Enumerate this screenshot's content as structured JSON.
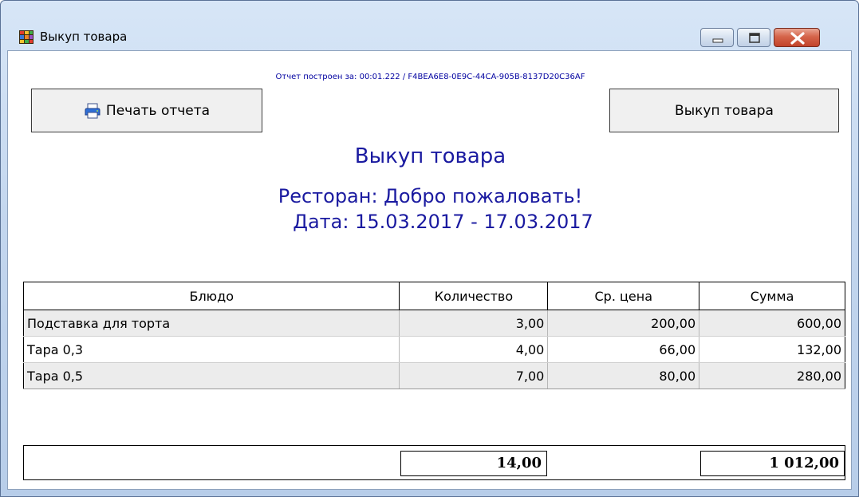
{
  "window": {
    "title": "Выкуп товара",
    "controls": [
      "minimize",
      "maximize",
      "close"
    ]
  },
  "report": {
    "build_info": "Отчет построен за: 00:01.222 / F4BEA6E8-0E9C-44CA-905B-8137D20C36AF",
    "print_button": "Печать отчета",
    "buyout_button": "Выкуп товара",
    "title": "Выкуп товара",
    "restaurant_line": "Ресторан: Добро пожаловать!",
    "date_line": "Дата: 15.03.2017 - 17.03.2017"
  },
  "table": {
    "columns": [
      "Блюдо",
      "Количество",
      "Ср. цена",
      "Сумма"
    ],
    "rows": [
      {
        "dish": "Подставка для торта",
        "qty": "3,00",
        "avg_price": "200,00",
        "sum": "600,00"
      },
      {
        "dish": "Тара 0,3",
        "qty": "4,00",
        "avg_price": "66,00",
        "sum": "132,00"
      },
      {
        "dish": "Тара 0,5",
        "qty": "7,00",
        "avg_price": "80,00",
        "sum": "280,00"
      }
    ],
    "totals": {
      "qty": "14,00",
      "sum": "1 012,00"
    }
  },
  "colors": {
    "report_text": "#1a1aa0",
    "build_info_text": "#0000a0",
    "close_button": "#c2432a"
  },
  "icons": {
    "app": "app-grid-icon",
    "print": "printer-icon"
  }
}
